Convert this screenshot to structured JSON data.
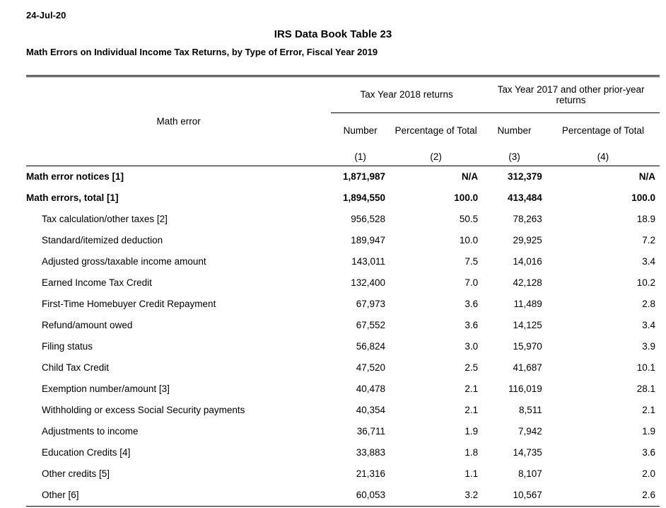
{
  "header": {
    "date": "24-Jul-20",
    "title": "IRS Data Book Table 23",
    "subtitle": "Math Errors on Individual Income Tax Returns, by Type of Error, Fiscal Year 2019"
  },
  "table": {
    "row_header": "Math error",
    "groups": [
      {
        "label": "Tax Year 2018 returns"
      },
      {
        "label": "Tax Year 2017 and other prior-year returns"
      }
    ],
    "subheaders": [
      "Number",
      "Percentage of Total",
      "Number",
      "Percentage of Total"
    ],
    "column_numbers": [
      "(1)",
      "(2)",
      "(3)",
      "(4)"
    ],
    "rows": [
      {
        "label": "Math error notices [1]",
        "values": [
          "1,871,987",
          "N/A",
          "312,379",
          "N/A"
        ],
        "bold": true
      },
      {
        "label": "Math errors, total [1]",
        "values": [
          "1,894,550",
          "100.0",
          "413,484",
          "100.0"
        ],
        "bold": true
      },
      {
        "label": "Tax calculation/other taxes [2]",
        "values": [
          "956,528",
          "50.5",
          "78,263",
          "18.9"
        ]
      },
      {
        "label": "Standard/itemized deduction",
        "values": [
          "189,947",
          "10.0",
          "29,925",
          "7.2"
        ]
      },
      {
        "label": "Adjusted gross/taxable income amount",
        "values": [
          "143,011",
          "7.5",
          "14,016",
          "3.4"
        ]
      },
      {
        "label": "Earned Income Tax Credit",
        "values": [
          "132,400",
          "7.0",
          "42,128",
          "10.2"
        ]
      },
      {
        "label": "First-Time Homebuyer Credit Repayment",
        "values": [
          "67,973",
          "3.6",
          "11,489",
          "2.8"
        ]
      },
      {
        "label": "Refund/amount owed",
        "values": [
          "67,552",
          "3.6",
          "14,125",
          "3.4"
        ]
      },
      {
        "label": "Filing status",
        "values": [
          "56,824",
          "3.0",
          "15,970",
          "3.9"
        ]
      },
      {
        "label": "Child Tax Credit",
        "values": [
          "47,520",
          "2.5",
          "41,687",
          "10.1"
        ]
      },
      {
        "label": "Exemption number/amount [3]",
        "values": [
          "40,478",
          "2.1",
          "116,019",
          "28.1"
        ]
      },
      {
        "label": "Withholding or excess Social Security payments",
        "values": [
          "40,354",
          "2.1",
          "8,511",
          "2.1"
        ]
      },
      {
        "label": "Adjustments to income",
        "values": [
          "36,711",
          "1.9",
          "7,942",
          "1.9"
        ]
      },
      {
        "label": "Education Credits [4]",
        "values": [
          "33,883",
          "1.8",
          "14,735",
          "3.6"
        ]
      },
      {
        "label": "Other credits [5]",
        "values": [
          "21,316",
          "1.1",
          "8,107",
          "2.0"
        ]
      },
      {
        "label": "Other [6]",
        "values": [
          "60,053",
          "3.2",
          "10,567",
          "2.6"
        ]
      }
    ]
  }
}
